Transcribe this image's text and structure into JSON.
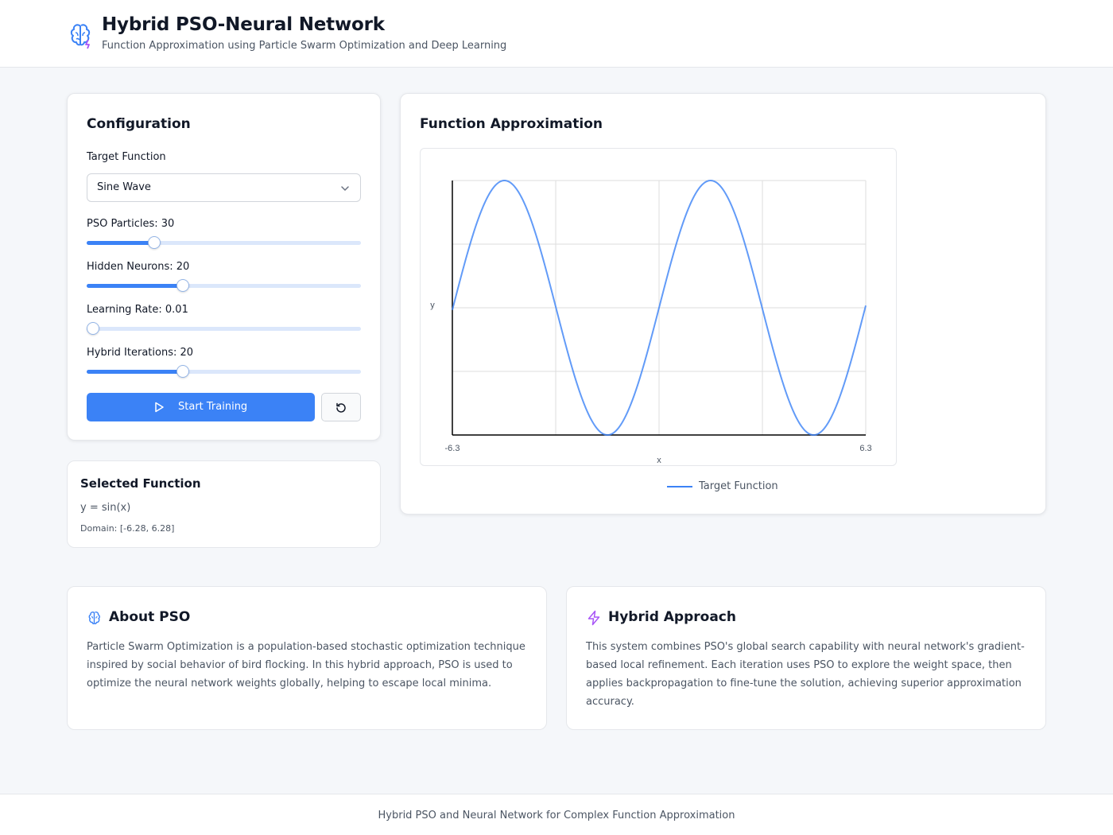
{
  "header": {
    "title": "Hybrid PSO-Neural Network",
    "subtitle": "Function Approximation using Particle Swarm Optimization and Deep Learning",
    "logo_icon": "brain-icon"
  },
  "config": {
    "title": "Configuration",
    "target_function_label": "Target Function",
    "target_function_value": "Sine Wave",
    "sliders": [
      {
        "label": "PSO Particles: 30",
        "fraction": 0.235
      },
      {
        "label": "Hidden Neurons: 20",
        "fraction": 0.343
      },
      {
        "label": "Learning Rate: 0.01",
        "fraction": 0.0
      },
      {
        "label": "Hybrid Iterations: 20",
        "fraction": 0.343
      }
    ],
    "start_label": "Start Training",
    "reset_icon": "reset-icon"
  },
  "selected_function": {
    "title": "Selected Function",
    "formula": "y = sin(x)",
    "domain": "Domain: [-6.28, 6.28]"
  },
  "approximation": {
    "title": "Function Approximation",
    "legend": "Target Function"
  },
  "chart_data": {
    "type": "line",
    "xlabel": "x",
    "ylabel": "y",
    "xlim": [
      -6.3,
      6.3
    ],
    "ylim": [
      -1,
      1
    ],
    "x_tick_labels": [
      "-6.3",
      "6.3"
    ],
    "grid": true,
    "legend_position": "bottom",
    "series": [
      {
        "name": "Target Function",
        "function": "sin(x)",
        "color": "#3b82f6",
        "x": [
          -6.28,
          -4.71,
          -3.14,
          -1.57,
          0,
          1.57,
          3.14,
          4.71,
          6.28
        ],
        "y": [
          0,
          1,
          0,
          -1,
          0,
          1,
          0,
          -1,
          0
        ]
      }
    ]
  },
  "about_pso": {
    "title": "About PSO",
    "icon": "brain-icon",
    "body": "Particle Swarm Optimization is a population-based stochastic optimization technique inspired by social behavior of bird flocking. In this hybrid approach, PSO is used to optimize the neural network weights globally, helping to escape local minima."
  },
  "hybrid_approach": {
    "title": "Hybrid Approach",
    "icon": "lightning-icon",
    "body": "This system combines PSO's global search capability with neural network's gradient-based local refinement. Each iteration uses PSO to explore the weight space, then applies backpropagation to fine-tune the solution, achieving superior approximation accuracy."
  },
  "footer": {
    "text": "Hybrid PSO and Neural Network for Complex Function Approximation"
  },
  "colors": {
    "accent": "#3b82f6",
    "purple": "#a855f7",
    "text": "#111827",
    "muted": "#4b5563"
  }
}
